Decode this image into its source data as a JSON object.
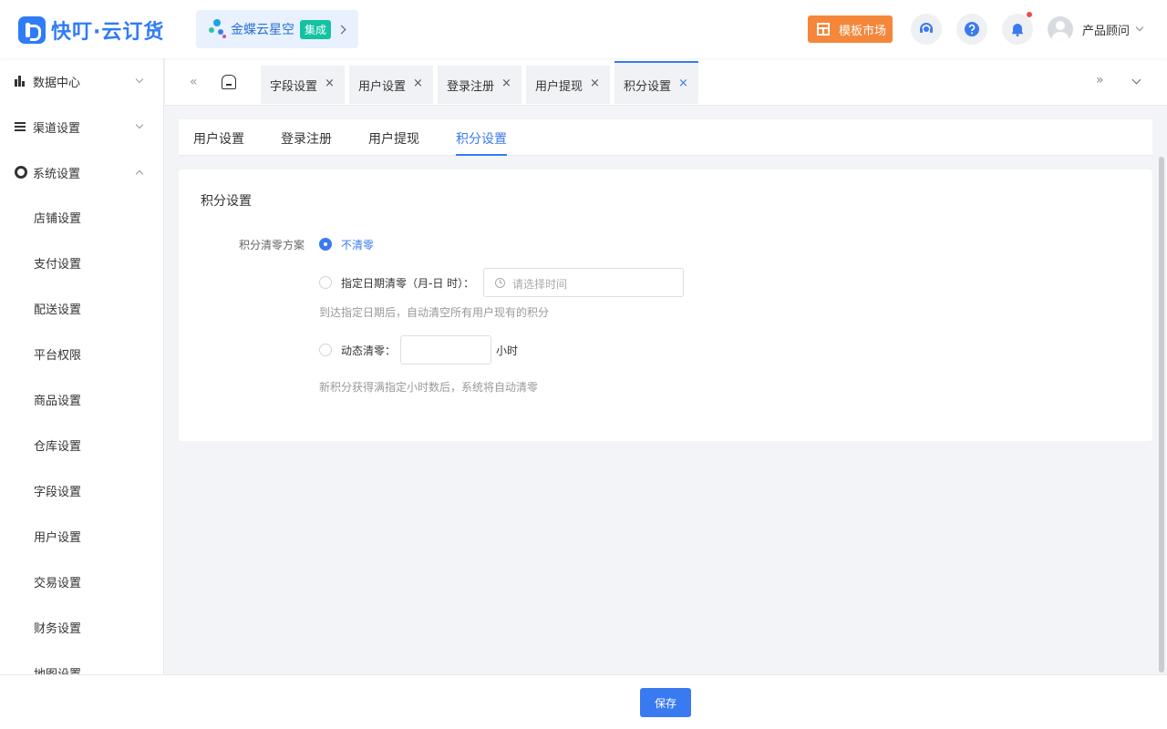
{
  "app": {
    "logo_text": "快叮·云订货"
  },
  "header": {
    "integration_name": "金蝶云星空",
    "integration_tag": "集成",
    "market_label": "模板市场",
    "user_name": "产品顾问"
  },
  "sidebar": {
    "groups": [
      {
        "label": "数据中心",
        "icon": "bar-chart-icon",
        "expanded": false
      },
      {
        "label": "渠道设置",
        "icon": "list-icon",
        "expanded": false
      },
      {
        "label": "系统设置",
        "icon": "gear-icon",
        "expanded": true
      }
    ],
    "items": [
      "店铺设置",
      "支付设置",
      "配送设置",
      "平台权限",
      "商品设置",
      "仓库设置",
      "字段设置",
      "用户设置",
      "交易设置",
      "财务设置",
      "地图设置"
    ]
  },
  "tabs": {
    "prev": "«",
    "next": "»",
    "close": "×",
    "open": [
      {
        "label": "字段设置",
        "active": false
      },
      {
        "label": "用户设置",
        "active": false
      },
      {
        "label": "登录注册",
        "active": false
      },
      {
        "label": "用户提现",
        "active": false
      },
      {
        "label": "积分设置",
        "active": true
      }
    ]
  },
  "subtabs": {
    "items": [
      "用户设置",
      "登录注册",
      "用户提现",
      "积分设置"
    ],
    "active_index": 3
  },
  "card": {
    "title": "积分设置",
    "field_label": "积分清零方案",
    "options": [
      {
        "label": "不清零",
        "checked": true
      },
      {
        "label": "指定日期清零（月-日 时）：",
        "checked": false
      },
      {
        "label": "动态清零：",
        "checked": false
      }
    ],
    "date_placeholder": "请选择时间",
    "date_hint": "到达指定日期后，自动清空所有用户现有的积分",
    "hours_value": "",
    "hours_unit": "小时",
    "hours_hint": "新积分获得满指定小时数后，系统将自动清零"
  },
  "footer": {
    "save_label": "保存"
  },
  "colors": {
    "primary": "#3a7af0",
    "accent": "#f5873b",
    "brand": "#2f7cf6",
    "tag": "#13c2a3"
  }
}
